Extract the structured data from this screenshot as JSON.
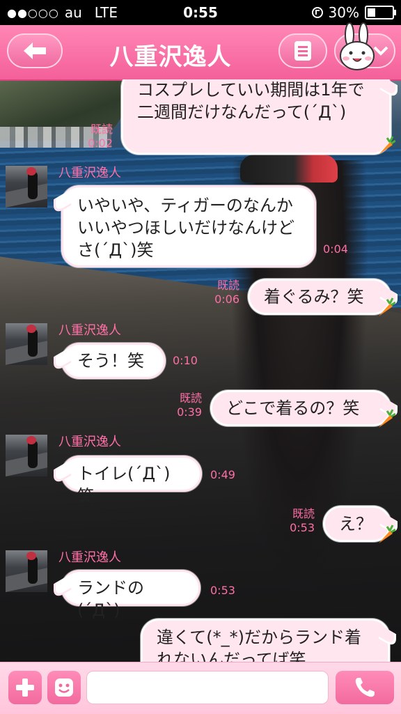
{
  "status_bar": {
    "signal": "●●○○○",
    "carrier": "au",
    "network": "LTE",
    "time": "0:55",
    "battery": "30%",
    "battery_level": 0.3
  },
  "header": {
    "title": "八重沢逸人",
    "back_icon": "arrow-left-icon",
    "menu_icon": "list-icon",
    "sticker_icon": "bunny-sticker-icon",
    "accent_color": "#f4609a"
  },
  "messages": [
    {
      "dir": "out",
      "text": "コスプレしていい期間は1年で二週間だけなんだって(´Д`)",
      "read": "既読",
      "time": "0:02"
    },
    {
      "dir": "in",
      "sender": "八重沢逸人",
      "text": "いやいや、ティガーのなんかいいやつほしいだけなんけどさ(´Д`)笑",
      "time": "0:04"
    },
    {
      "dir": "out",
      "text": "着ぐるみ？笑",
      "read": "既読",
      "time": "0:06"
    },
    {
      "dir": "in",
      "sender": "八重沢逸人",
      "text": "そう！笑",
      "time": "0:10"
    },
    {
      "dir": "out",
      "text": "どこで着るの？笑",
      "read": "既読",
      "time": "0:39"
    },
    {
      "dir": "in",
      "sender": "八重沢逸人",
      "text": "トイレ(´Д`)笑",
      "time": "0:49"
    },
    {
      "dir": "out",
      "text": "え？",
      "read": "既読",
      "time": "0:53"
    },
    {
      "dir": "in",
      "sender": "八重沢逸人",
      "text": "ランドの(´Д`)",
      "time": "0:53"
    },
    {
      "dir": "out",
      "text": "違くて(*_*)だからランド着れないんだってば笑",
      "read": "",
      "time": ""
    }
  ],
  "input_bar": {
    "plus_icon": "plus-icon",
    "emoji_icon": "emoji-icon",
    "placeholder": "",
    "call_icon": "phone-icon"
  }
}
